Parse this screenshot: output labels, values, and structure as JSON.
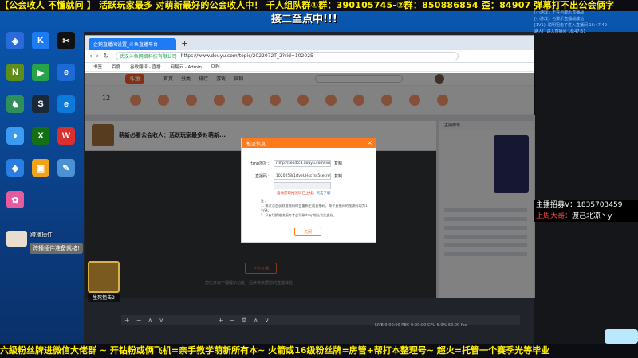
{
  "banner": {
    "top": "【公会收人 不懂就问 】 活跃玩家最多 对萌新最好的公会收人中！ 千人组队群①群：390105745-②群：850886854 歪：84907 弹幕打不出公会俩字",
    "second": "接二至点中!!!",
    "bottom": "六級粉丝牌进微信大佬群 ~ 开钻粉或俩飞机=亲手教学萌新所有本~   火箭或16级粉丝牌=房管+帮打本整理号~   超火=托管一个赛季光等毕业"
  },
  "desktop_icons": [
    {
      "label": "",
      "icon": "shield-icon",
      "color": "#2a6bd9",
      "glyph": "◈"
    },
    {
      "label": "",
      "icon": "k-icon",
      "color": "#1d7cf2",
      "glyph": "K"
    },
    {
      "label": "",
      "icon": "capcut-icon",
      "color": "#111111",
      "glyph": "✂"
    },
    {
      "label": "",
      "icon": "nvidia-icon",
      "color": "#5d8d1a",
      "glyph": "N"
    },
    {
      "label": "",
      "icon": "media-icon",
      "color": "#27a34a",
      "glyph": "▶"
    },
    {
      "label": "",
      "icon": "ie-icon",
      "color": "#1b6ad6",
      "glyph": "e"
    },
    {
      "label": "",
      "icon": "game-icon",
      "color": "#2f8f5b",
      "glyph": "♞"
    },
    {
      "label": "",
      "icon": "steam-icon",
      "color": "#1b2838",
      "glyph": "S"
    },
    {
      "label": "",
      "icon": "edge-icon",
      "color": "#0c7adb",
      "glyph": "e"
    },
    {
      "label": "",
      "icon": "app-icon",
      "color": "#3b9bf0",
      "glyph": "♦"
    },
    {
      "label": "",
      "icon": "xbox-icon",
      "color": "#137013",
      "glyph": "X"
    },
    {
      "label": "",
      "icon": "wps-icon",
      "color": "#d92f2f",
      "glyph": "W"
    },
    {
      "label": "",
      "icon": "plugin-icon",
      "color": "#2a7de1",
      "glyph": "◆"
    },
    {
      "label": "",
      "icon": "media-player-icon",
      "color": "#f0a21b",
      "glyph": "▣"
    },
    {
      "label": "",
      "icon": "notepad-icon",
      "color": "#4a91d6",
      "glyph": "✎"
    },
    {
      "label": "",
      "icon": "paint-icon",
      "color": "#e85a9f",
      "glyph": "✿"
    }
  ],
  "browser": {
    "tab_title": "企鹅直播间设置_斗鱼直播平台",
    "url_site": "武汉斗鱼网络科技有限公司",
    "url": "https://www.douyu.com/topic/2022072T_2?rid=102025",
    "bookmarks": [
      "书签",
      "百度",
      "谷歌翻译 - 直播",
      "网易云 - Admin",
      "DIM"
    ],
    "nav": [
      "首页",
      "分类",
      "排行",
      "游戏",
      "福利"
    ],
    "categories": [
      "12",
      "",
      "",
      "",
      "",
      "",
      "",
      "",
      "",
      "",
      "",
      "",
      ""
    ],
    "room_title": "萌新必看公会收人：活跃玩家最多对萌新..."
  },
  "modal": {
    "title": "推流信息",
    "close": "×",
    "rtmp_label": "rtmp地址：",
    "rtmp_value": "rtmp://sendtc3.douyu.com/live",
    "key_label": "直播码：",
    "key_value": "1020258r1rtyeUHsc?ss5secret=••••••",
    "copy": "复制",
    "auto_note": "自动获取推流码已上线，",
    "auto_link": "点击了解",
    "note_title": "注：",
    "notes": [
      "1. 每次点击获取推流码时会重新生成直播码，每个直播间的推流码均为1分钟。",
      "2. 只有切换推流服务才会导致rtmp地址发生变化。"
    ],
    "confirm": "关闭"
  },
  "stream": {
    "start_button": "开始直播",
    "hint": "您已开启下播提示功能，后续将依据您的直播体验"
  },
  "right_panel": {
    "header": "主播榜单"
  },
  "overlays": {
    "plugin_name": "跨播插件",
    "plugin_ready": "跨播插件准备就绪!",
    "gift_label": "生死狙击2"
  },
  "obs": {
    "controls": [
      "+",
      "−",
      "∧",
      "∨",
      "+",
      "−",
      "⚙",
      "∧",
      "∨"
    ],
    "status": "LIVE 0:00:00  REC 0:00:00  CPU 6.0%  60.00 fps"
  },
  "chat": {
    "lines": [
      "[小游戏]: 正在与聚乐直播战",
      "[小游戏]: 与聚乐直播战成功",
      "[1V1]: 聪明狙击了进入直播间 16:47:49",
      "路人[] 进入直播间 16:47:51"
    ],
    "recruit": "主播招募V：1835703459",
    "captain_label": "上周大哥：",
    "captain_name": "渡己北凉丶y"
  }
}
